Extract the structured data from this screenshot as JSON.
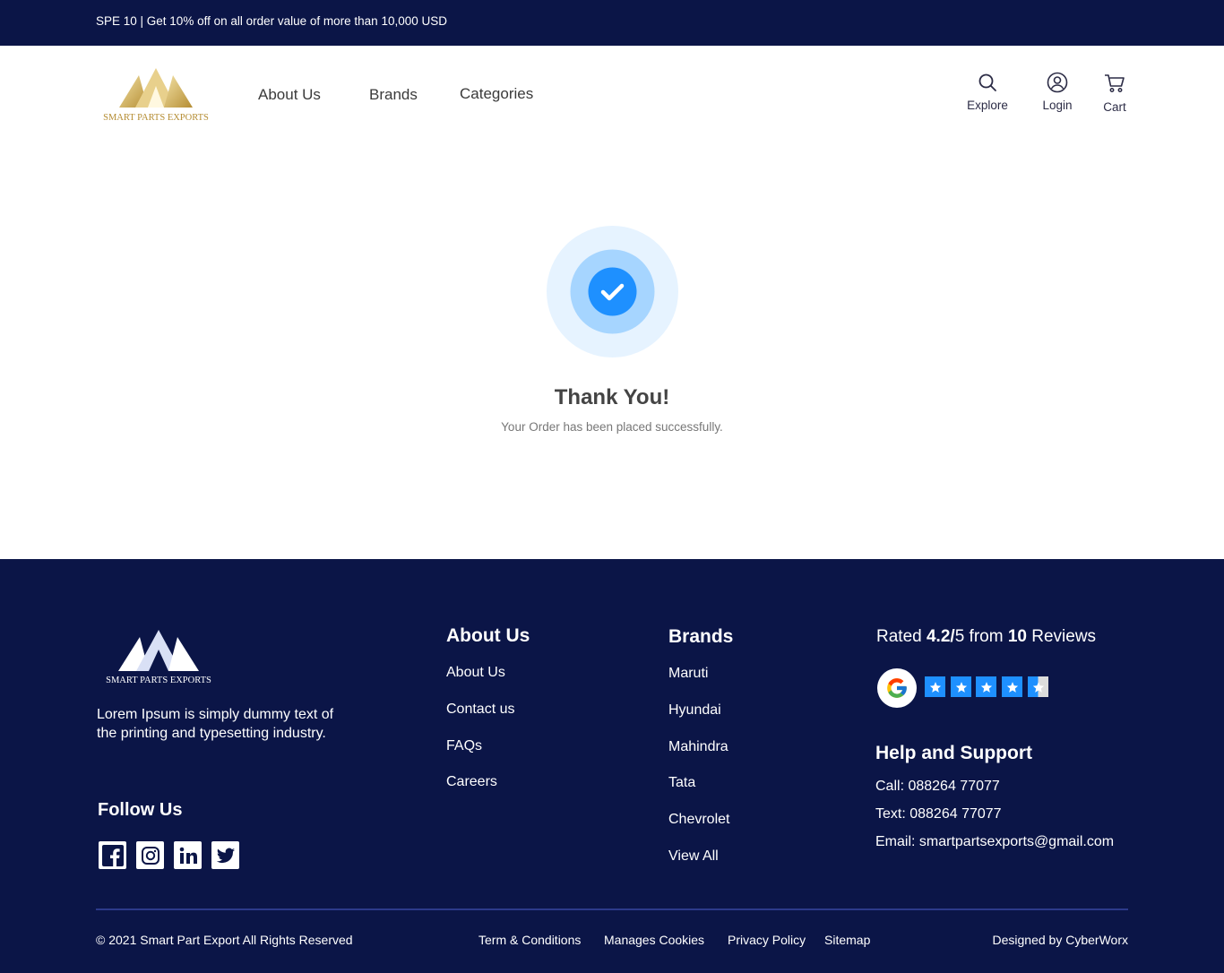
{
  "promo": {
    "text": "SPE 10 | Get 10% off on all order value of more than 10,000 USD"
  },
  "brand": {
    "name": "SMART PARTS EXPORTS",
    "gold": "#c9a94f",
    "navy": "#0b1547",
    "accent": "#1e90ff"
  },
  "nav": {
    "links": [
      "About Us",
      "Brands",
      "Categories"
    ],
    "explore": {
      "label": "Explore",
      "icon": "search-icon"
    },
    "login": {
      "label": "Login",
      "icon": "user-icon"
    },
    "cart": {
      "label": "Cart",
      "icon": "cart-icon"
    }
  },
  "confirmation": {
    "icon": "check-icon",
    "title": "Thank You!",
    "message": "Your Order has been placed successfully."
  },
  "footer": {
    "description": "Lorem Ipsum is simply dummy text of the printing and typesetting industry.",
    "follow_title": "Follow Us",
    "social": [
      "facebook-icon",
      "instagram-icon",
      "linkedin-icon",
      "twitter-icon"
    ],
    "about": {
      "title": "About Us",
      "links": [
        "About Us",
        "Contact us",
        "FAQs",
        "Careers"
      ]
    },
    "brands": {
      "title": "Brands",
      "links": [
        "Maruti",
        "Hyundai",
        "Mahindra",
        "Tata",
        "Chevrolet",
        "View All"
      ]
    },
    "rating": {
      "prefix": "Rated",
      "score": "4.2/",
      "scale": "5",
      "from": "from",
      "count": "10",
      "suffix": "Reviews",
      "stars": 4.5
    },
    "help": {
      "title": "Help and Support",
      "call": "Call: 088264 77077",
      "text": "Text: 088264 77077",
      "email": "Email: smartpartsexports@gmail.com"
    },
    "copyright": "© 2021 Smart Part Export All Rights Reserved",
    "bottom_links": [
      "Term & Conditions",
      "Manages Cookies",
      "Privacy Policy",
      "Sitemap"
    ],
    "credit": "Designed by CyberWorx"
  }
}
